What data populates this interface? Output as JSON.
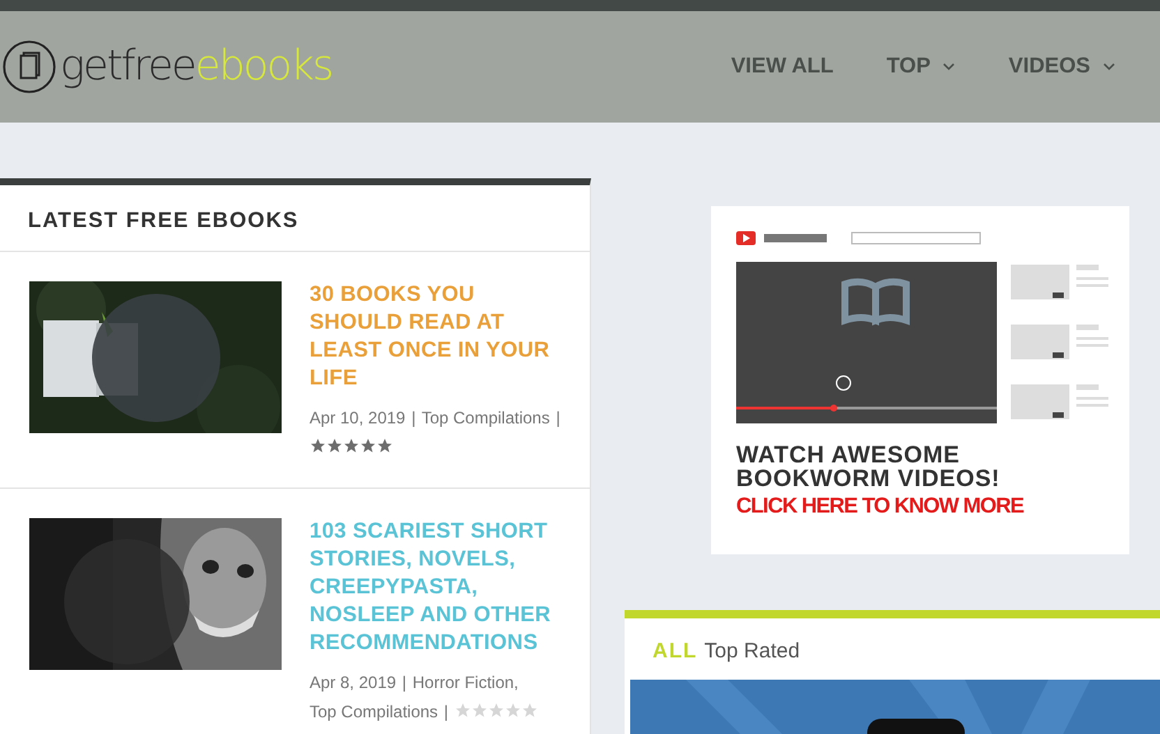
{
  "logo": {
    "text_dark": "getfree",
    "text_accent": "ebooks"
  },
  "nav": [
    {
      "label": "VIEW ALL",
      "has_menu": false
    },
    {
      "label": "TOP",
      "has_menu": true
    },
    {
      "label": "VIDEOS",
      "has_menu": true
    }
  ],
  "latest": {
    "title": "LATEST FREE EBOOKS",
    "articles": [
      {
        "title": "30 BOOKS YOU SHOULD READ AT LEAST ONCE IN YOUR LIFE",
        "color": "#eaa03a",
        "date": "Apr 10, 2019",
        "separators": [
          "|",
          "|"
        ],
        "categories": [
          "Top Compilations"
        ],
        "stars": 5,
        "thumbnail": {
          "kind": "picture"
        }
      },
      {
        "title": "103 SCARIEST SHORT STORIES, NOVELS, CREEPYPASTA, NOSLEEP AND OTHER RECOMMENDATIONS",
        "color": "#5bc3d6",
        "date": "Apr 8, 2019",
        "separators": [
          "|",
          "|"
        ],
        "categories": [
          "Horror Fiction,",
          "Top Compilations"
        ],
        "stars": 0,
        "thumbnail": {
          "kind": "picture"
        }
      }
    ]
  },
  "ad": {
    "headline": "WATCH AWESOME BOOKWORM VIDEOS!",
    "call_to_action": "CLICK HERE TO KNOW MORE"
  },
  "top_rated": {
    "accent": "ALL",
    "title": "Top Rated"
  }
}
